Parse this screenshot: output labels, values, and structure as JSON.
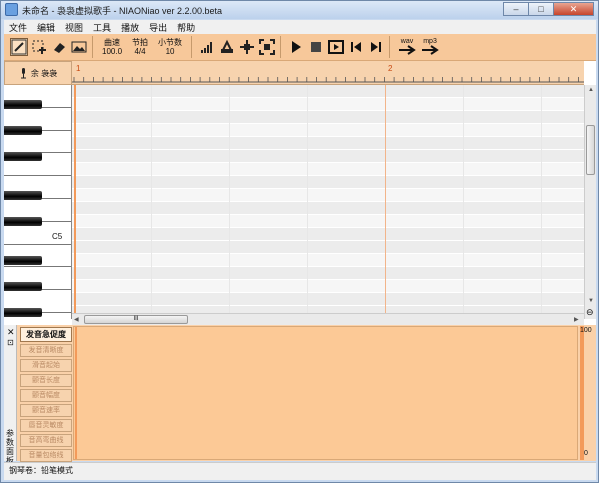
{
  "window": {
    "title": "未命名 - 袅袅虚拟歌手 - NIAONiao ver 2.2.00.beta",
    "buttons": [
      "–",
      "□",
      "✕"
    ]
  },
  "menu": [
    "文件",
    "编辑",
    "视图",
    "工具",
    "播放",
    "导出",
    "帮助"
  ],
  "toolbar": {
    "tempo": {
      "label": "曲速",
      "value": "100.0"
    },
    "beat": {
      "label": "节拍",
      "value": "4/4"
    },
    "measures": {
      "label": "小节数",
      "value": "10"
    },
    "export_wav": "wav",
    "export_mp3": "mp3",
    "icons": [
      "pencil-icon",
      "select-icon",
      "eraser-icon",
      "image-icon",
      "volume-bars-icon",
      "lyrics-icon",
      "move-icon",
      "fit-icon",
      "play-icon",
      "stop-icon",
      "loop-play-icon",
      "prev-icon",
      "next-icon"
    ]
  },
  "track": {
    "header_label": "余 袅袅",
    "ruler_marks": [
      "1",
      "2"
    ],
    "note_label": "C5"
  },
  "bottom": {
    "side_label": "参数面板",
    "params": [
      "发音急促度",
      "发音清晰度",
      "滑音起始",
      "颤音长度",
      "颤音幅度",
      "颤音速率",
      "唇音灵敏度",
      "音高弯曲线",
      "音量包络线"
    ],
    "scale_max": "100",
    "scale_min": "0"
  },
  "status": "钢琴卷：铅笔模式",
  "scroll": {
    "h_thumb_label": "III"
  },
  "colors": {
    "accent": "#f39a5a",
    "toolbar": "#f7c89a",
    "panel": "#fad1a9"
  }
}
